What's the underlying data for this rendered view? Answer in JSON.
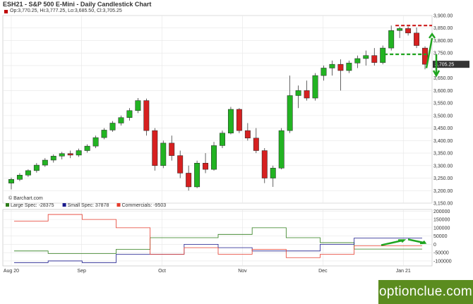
{
  "title": "ESH21 - S&P 500 E-Mini - Daily Candlestick Chart",
  "ohlc_label": "Op:3,770.25, Hi:3,777.25, Lo:3,685.50, Cl:3,705.25",
  "source_label": "© Barchart.com",
  "watermark": "optionclue.com",
  "last_price_label": "3,705.25",
  "chart_data": [
    {
      "type": "candlestick",
      "x_labels": [
        {
          "label": "Aug 20",
          "index": 0
        },
        {
          "label": "Sep",
          "index": 7
        },
        {
          "label": "Oct",
          "index": 15
        },
        {
          "label": "Nov",
          "index": 23
        },
        {
          "label": "Dec",
          "index": 31
        },
        {
          "label": "Jan 21",
          "index": 39
        }
      ],
      "y_ticks": [
        3150,
        3200,
        3250,
        3300,
        3350,
        3400,
        3450,
        3500,
        3550,
        3600,
        3650,
        3700,
        3750,
        3800,
        3850,
        3900
      ],
      "y_tick_labels": [
        "3,150.00",
        "3,200.00",
        "3,250.00",
        "3,300.00",
        "3,350.00",
        "3,400.00",
        "3,450.00",
        "3,500.00",
        "3,550.00",
        "3,600.00",
        "3,650.00",
        "3,700.00",
        "3,750.00",
        "3,800.00",
        "3,850.00",
        "3,900.00"
      ],
      "ylim": [
        3150,
        3900
      ],
      "candles": [
        {
          "o": 3230,
          "h": 3252,
          "l": 3205,
          "c": 3245
        },
        {
          "o": 3245,
          "h": 3270,
          "l": 3238,
          "c": 3262
        },
        {
          "o": 3262,
          "h": 3285,
          "l": 3255,
          "c": 3280
        },
        {
          "o": 3280,
          "h": 3310,
          "l": 3272,
          "c": 3302
        },
        {
          "o": 3302,
          "h": 3330,
          "l": 3295,
          "c": 3322
        },
        {
          "o": 3322,
          "h": 3345,
          "l": 3312,
          "c": 3338
        },
        {
          "o": 3338,
          "h": 3355,
          "l": 3325,
          "c": 3348
        },
        {
          "o": 3348,
          "h": 3360,
          "l": 3330,
          "c": 3342
        },
        {
          "o": 3342,
          "h": 3368,
          "l": 3335,
          "c": 3360
        },
        {
          "o": 3360,
          "h": 3385,
          "l": 3352,
          "c": 3378
        },
        {
          "o": 3378,
          "h": 3420,
          "l": 3370,
          "c": 3412
        },
        {
          "o": 3412,
          "h": 3450,
          "l": 3405,
          "c": 3442
        },
        {
          "o": 3442,
          "h": 3478,
          "l": 3435,
          "c": 3470
        },
        {
          "o": 3470,
          "h": 3500,
          "l": 3460,
          "c": 3492
        },
        {
          "o": 3492,
          "h": 3530,
          "l": 3480,
          "c": 3520
        },
        {
          "o": 3520,
          "h": 3570,
          "l": 3510,
          "c": 3560
        },
        {
          "o": 3560,
          "h": 3568,
          "l": 3420,
          "c": 3440
        },
        {
          "o": 3440,
          "h": 3450,
          "l": 3280,
          "c": 3300
        },
        {
          "o": 3300,
          "h": 3400,
          "l": 3290,
          "c": 3390
        },
        {
          "o": 3390,
          "h": 3420,
          "l": 3320,
          "c": 3340
        },
        {
          "o": 3340,
          "h": 3360,
          "l": 3250,
          "c": 3270
        },
        {
          "o": 3270,
          "h": 3300,
          "l": 3200,
          "c": 3215
        },
        {
          "o": 3215,
          "h": 3320,
          "l": 3210,
          "c": 3310
        },
        {
          "o": 3310,
          "h": 3350,
          "l": 3270,
          "c": 3285
        },
        {
          "o": 3285,
          "h": 3395,
          "l": 3280,
          "c": 3380
        },
        {
          "o": 3380,
          "h": 3440,
          "l": 3370,
          "c": 3430
        },
        {
          "o": 3430,
          "h": 3535,
          "l": 3425,
          "c": 3525
        },
        {
          "o": 3525,
          "h": 3530,
          "l": 3430,
          "c": 3440
        },
        {
          "o": 3440,
          "h": 3470,
          "l": 3400,
          "c": 3410
        },
        {
          "o": 3410,
          "h": 3450,
          "l": 3350,
          "c": 3360
        },
        {
          "o": 3360,
          "h": 3370,
          "l": 3230,
          "c": 3250
        },
        {
          "o": 3250,
          "h": 3300,
          "l": 3215,
          "c": 3290
        },
        {
          "o": 3290,
          "h": 3450,
          "l": 3285,
          "c": 3440
        },
        {
          "o": 3440,
          "h": 3660,
          "l": 3430,
          "c": 3580
        },
        {
          "o": 3580,
          "h": 3620,
          "l": 3530,
          "c": 3600
        },
        {
          "o": 3600,
          "h": 3640,
          "l": 3560,
          "c": 3570
        },
        {
          "o": 3570,
          "h": 3670,
          "l": 3560,
          "c": 3660
        },
        {
          "o": 3660,
          "h": 3700,
          "l": 3640,
          "c": 3690
        },
        {
          "o": 3690,
          "h": 3720,
          "l": 3660,
          "c": 3705
        },
        {
          "o": 3705,
          "h": 3725,
          "l": 3600,
          "c": 3680
        },
        {
          "o": 3680,
          "h": 3720,
          "l": 3670,
          "c": 3710
        },
        {
          "o": 3710,
          "h": 3740,
          "l": 3690,
          "c": 3728
        },
        {
          "o": 3728,
          "h": 3760,
          "l": 3700,
          "c": 3740
        },
        {
          "o": 3740,
          "h": 3770,
          "l": 3700,
          "c": 3712
        },
        {
          "o": 3712,
          "h": 3780,
          "l": 3705,
          "c": 3770
        },
        {
          "o": 3770,
          "h": 3860,
          "l": 3760,
          "c": 3840
        },
        {
          "o": 3840,
          "h": 3855,
          "l": 3810,
          "c": 3848
        },
        {
          "o": 3848,
          "h": 3856,
          "l": 3820,
          "c": 3830
        },
        {
          "o": 3830,
          "h": 3852,
          "l": 3770,
          "c": 3780
        },
        {
          "o": 3770,
          "h": 3777,
          "l": 3685,
          "c": 3705
        }
      ]
    },
    {
      "type": "line",
      "legend": [
        {
          "name": "Large Spec: -28375",
          "color": "#2e7d1a"
        },
        {
          "name": "Small Spec: 37878",
          "color": "#1a1a8c"
        },
        {
          "name": "Commercials: -9503",
          "color": "#e53b2c"
        }
      ],
      "y_ticks": [
        200000,
        150000,
        100000,
        50000,
        0,
        -50000,
        -100000
      ],
      "y_tick_labels": [
        "200000",
        "150000",
        "100000",
        "50000",
        "0",
        "-50000",
        "-100000"
      ],
      "ylim": [
        -130000,
        210000
      ],
      "series": [
        {
          "name": "Large Spec: -28375",
          "color": "#2e7d1a",
          "values": [
            -40000,
            -55000,
            -55000,
            -30000,
            40000,
            40000,
            60000,
            100000,
            40000,
            10000,
            -28375,
            -28375
          ]
        },
        {
          "name": "Small Spec: 37878",
          "color": "#1a1a8c",
          "values": [
            -110000,
            -100000,
            -110000,
            -60000,
            -60000,
            0,
            -20000,
            -40000,
            -40000,
            0,
            37878,
            37878
          ]
        },
        {
          "name": "Commercials: -9503",
          "color": "#e53b2c",
          "values": [
            140000,
            180000,
            150000,
            100000,
            -60000,
            -20000,
            -60000,
            -30000,
            -80000,
            -60000,
            -9503,
            -9503
          ]
        }
      ],
      "step_count": 12
    }
  ]
}
